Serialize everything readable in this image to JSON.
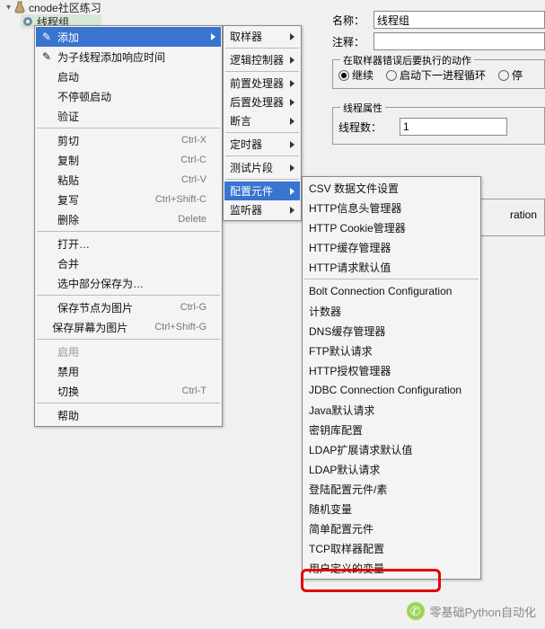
{
  "tree": {
    "root": "cnode社区练习",
    "node": "线程组"
  },
  "form": {
    "name_label": "名称：",
    "name_value": "线程组",
    "comment_label": "注释：",
    "comment_value": "",
    "sampler_error": {
      "legend": "在取样器错误后要执行的动作",
      "continue": "继续",
      "start_next": "启动下一进程循环",
      "stop": "停"
    },
    "thread_props": {
      "legend": "线程属性",
      "threads_label": "线程数：",
      "threads_value": "1"
    },
    "cutoff_box": "ration"
  },
  "context_menu": {
    "add": "添加",
    "think_time": "为子线程添加响应时间",
    "start": "启动",
    "start_no_pause": "不停顿启动",
    "validate": "验证",
    "cut": {
      "label": "剪切",
      "shortcut": "Ctrl-X"
    },
    "copy": {
      "label": "复制",
      "shortcut": "Ctrl-C"
    },
    "paste": {
      "label": "粘贴",
      "shortcut": "Ctrl-V"
    },
    "duplicate": {
      "label": "复写",
      "shortcut": "Ctrl+Shift-C"
    },
    "delete_": {
      "label": "删除",
      "shortcut": "Delete"
    },
    "open": "打开…",
    "merge": "合并",
    "save_sel": "选中部分保存为…",
    "save_node_img": {
      "label": "保存节点为图片",
      "shortcut": "Ctrl-G"
    },
    "save_screen_img": {
      "label": "保存屏幕为图片",
      "shortcut": "Ctrl+Shift-G"
    },
    "enable": "启用",
    "disable": "禁用",
    "toggle": {
      "label": "切换",
      "shortcut": "Ctrl-T"
    },
    "help": "帮助"
  },
  "submenu": {
    "sampler": "取样器",
    "logic": "逻辑控制器",
    "pre": "前置处理器",
    "post": "后置处理器",
    "assert": "断言",
    "timer": "定时器",
    "testfrag": "测试片段",
    "config": "配置元件",
    "listener": "监听器"
  },
  "config_menu": [
    "CSV 数据文件设置",
    "HTTP信息头管理器",
    "HTTP Cookie管理器",
    "HTTP缓存管理器",
    "HTTP请求默认值",
    "Bolt Connection Configuration",
    "计数器",
    "DNS缓存管理器",
    "FTP默认请求",
    "HTTP授权管理器",
    "JDBC Connection Configuration",
    "Java默认请求",
    "密钥库配置",
    "LDAP扩展请求默认值",
    "LDAP默认请求",
    "登陆配置元件/素",
    "随机变量",
    "简单配置元件",
    "TCP取样器配置",
    "用户定义的变量"
  ],
  "watermark": "零基础Python自动化"
}
